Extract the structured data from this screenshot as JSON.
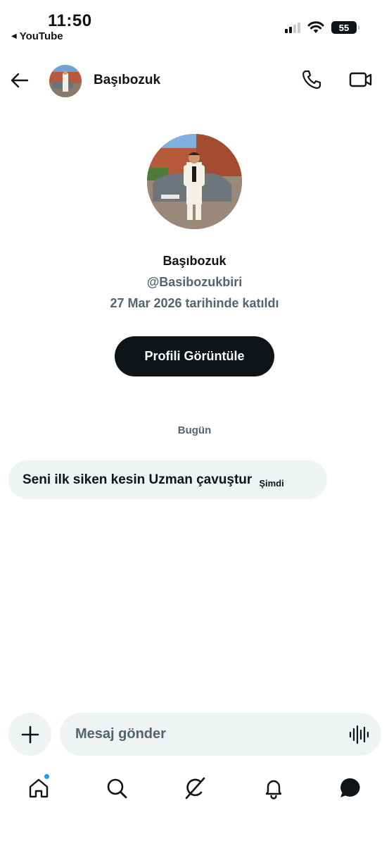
{
  "status_bar": {
    "time": "11:50",
    "back_app": "YouTube",
    "battery": "55"
  },
  "header": {
    "name": "Başıbozuk"
  },
  "profile": {
    "name": "Başıbozuk",
    "handle": "@Basibozukbiri",
    "joined": "27 Mar 2026 tarihinde katıldı",
    "view_button": "Profili Görüntüle"
  },
  "conversation": {
    "day_label": "Bugün",
    "messages": [
      {
        "text": "Seni ilk siken kesin Uzman çavuştur",
        "time": "Şimdi"
      }
    ]
  },
  "composer": {
    "placeholder": "Mesaj gönder"
  },
  "nav": {
    "items": [
      "home-icon",
      "search-icon",
      "grok-icon",
      "notifications-icon",
      "messages-icon"
    ]
  },
  "colors": {
    "text": "#0f1419",
    "muted": "#536471",
    "bubble": "#eff3f4",
    "accent": "#1d9bf0"
  }
}
